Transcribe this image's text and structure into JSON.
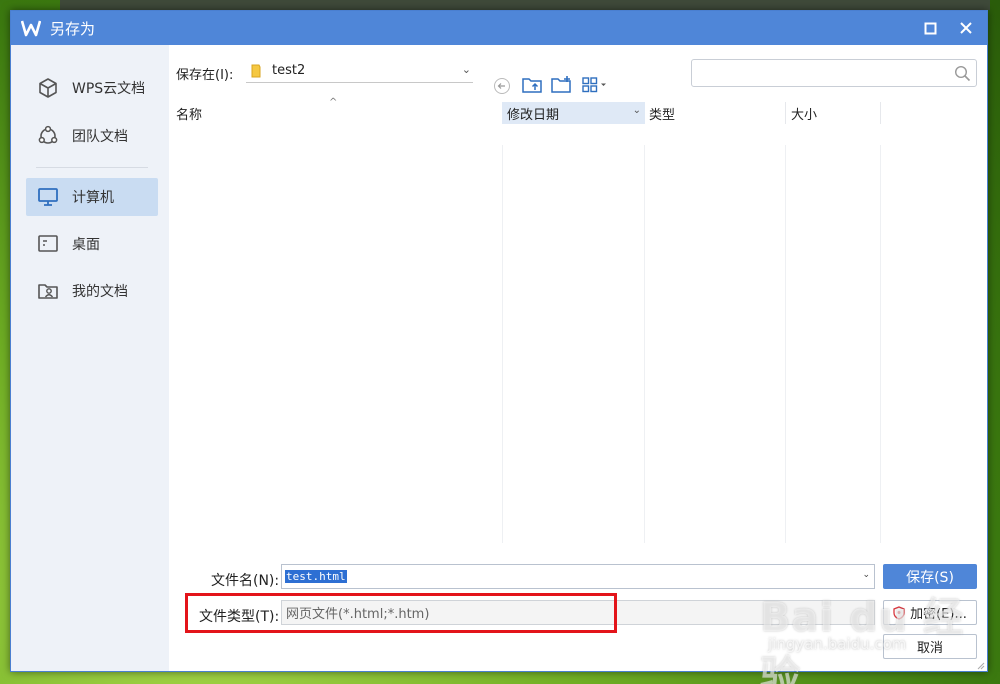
{
  "window": {
    "title": "另存为"
  },
  "sidebar": {
    "items": [
      {
        "label": "WPS云文档",
        "icon": "cube-icon"
      },
      {
        "label": "团队文档",
        "icon": "team-icon"
      },
      {
        "label": "计算机",
        "icon": "monitor-icon",
        "active": true
      },
      {
        "label": "桌面",
        "icon": "desktop-icon"
      },
      {
        "label": "我的文档",
        "icon": "user-folder-icon"
      }
    ]
  },
  "toolbar": {
    "location_label": "保存在(I):",
    "location_value": "test2",
    "search_placeholder": ""
  },
  "columns": [
    "名称",
    "修改日期",
    "类型",
    "大小"
  ],
  "form": {
    "filename_label": "文件名(N):",
    "filename_value": "test.html",
    "filetype_label": "文件类型(T):",
    "filetype_value": "网页文件(*.html;*.htm)"
  },
  "buttons": {
    "save": "保存(S)",
    "encrypt": "加密(E)...",
    "cancel": "取消"
  },
  "watermark": {
    "logo": "Bai du 经验",
    "sub": "jingyan.baidu.com"
  },
  "colors": {
    "accent": "#4f86d8",
    "highlight_border": "#e3141a",
    "sidebar_bg": "#eef2f8",
    "sidebar_active": "#c9dcf2"
  }
}
